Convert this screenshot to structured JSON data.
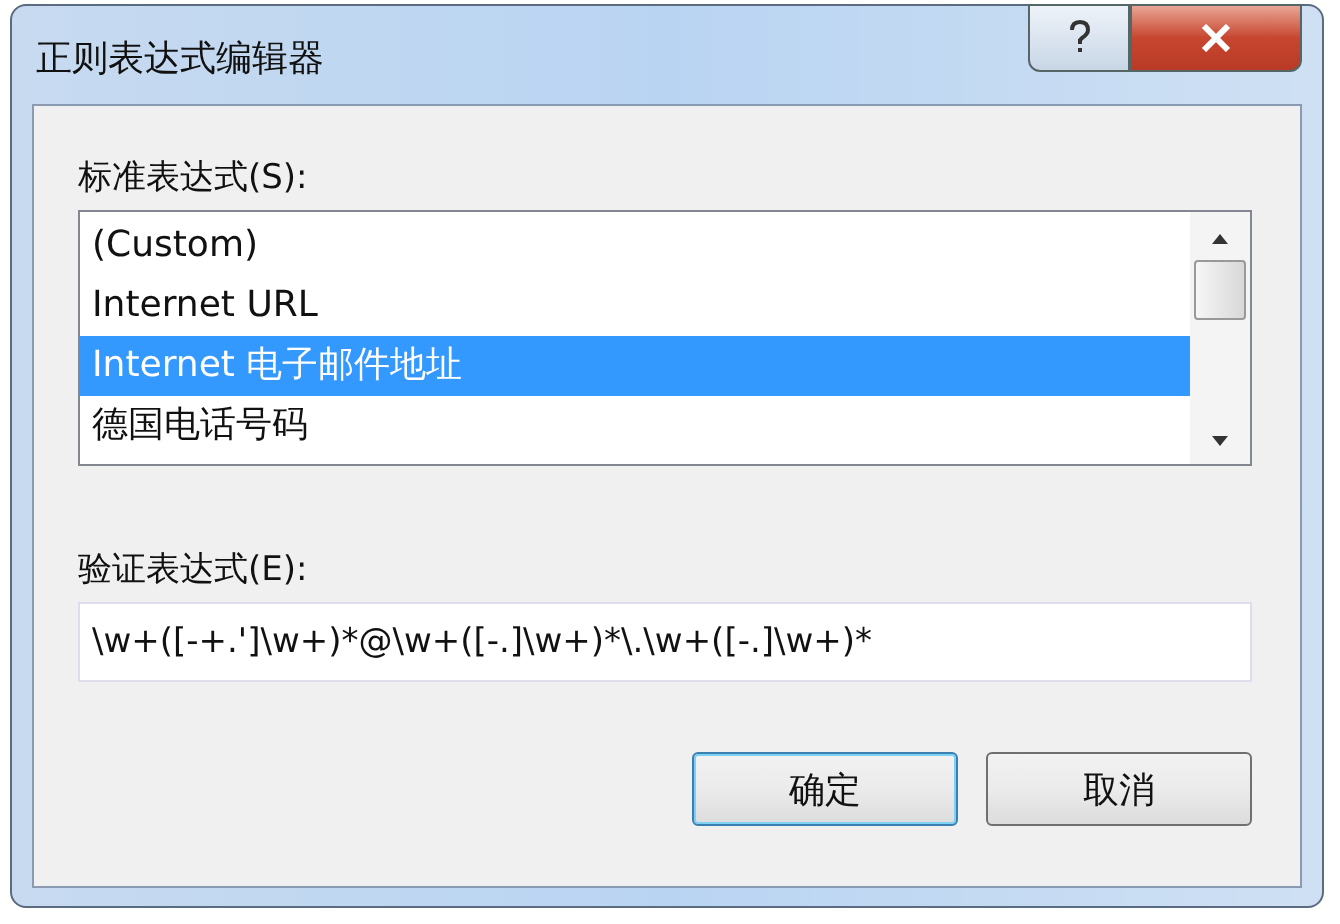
{
  "window": {
    "title": "正则表达式编辑器"
  },
  "standard": {
    "label": "标准表达式(S):",
    "items": [
      {
        "label": "(Custom)",
        "selected": false
      },
      {
        "label": "Internet URL",
        "selected": false
      },
      {
        "label": "Internet 电子邮件地址",
        "selected": true
      },
      {
        "label": "德国电话号码",
        "selected": false
      }
    ]
  },
  "validation": {
    "label": "验证表达式(E):",
    "value": "\\w+([-+.']\\w+)*@\\w+([-.]\\w+)*\\.\\w+([-.]\\w+)*"
  },
  "buttons": [
    {
      "label": "确定",
      "kind": "default"
    },
    {
      "label": "取消",
      "kind": "normal"
    }
  ]
}
